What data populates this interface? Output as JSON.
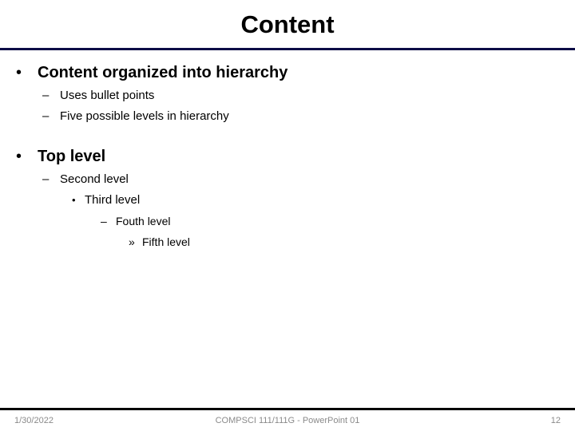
{
  "slide": {
    "title": "Content",
    "accent_color": "#0d0d46",
    "footer_rule_color": "#000000",
    "background_color": "#ffffff",
    "text_color": "#000000",
    "footer_text_color": "#8a8a8a"
  },
  "body": {
    "groups": [
      {
        "items": [
          {
            "level": 1,
            "marker": "•",
            "text": "Content organized into hierarchy"
          },
          {
            "level": 2,
            "marker": "–",
            "text": "Uses bullet points"
          },
          {
            "level": 2,
            "marker": "–",
            "text": "Five possible levels in hierarchy"
          }
        ]
      },
      {
        "items": [
          {
            "level": 1,
            "marker": "•",
            "text": "Top level"
          },
          {
            "level": 2,
            "marker": "–",
            "text": "Second level"
          },
          {
            "level": 3,
            "marker": "•",
            "text": "Third level"
          },
          {
            "level": 4,
            "marker": "–",
            "text": "Fouth level"
          },
          {
            "level": 5,
            "marker": "»",
            "text": "Fifth level"
          }
        ]
      }
    ]
  },
  "footer": {
    "date": "1/30/2022",
    "center_text": "COMPSCI 111/111G - PowerPoint 01",
    "page_number": "12"
  }
}
